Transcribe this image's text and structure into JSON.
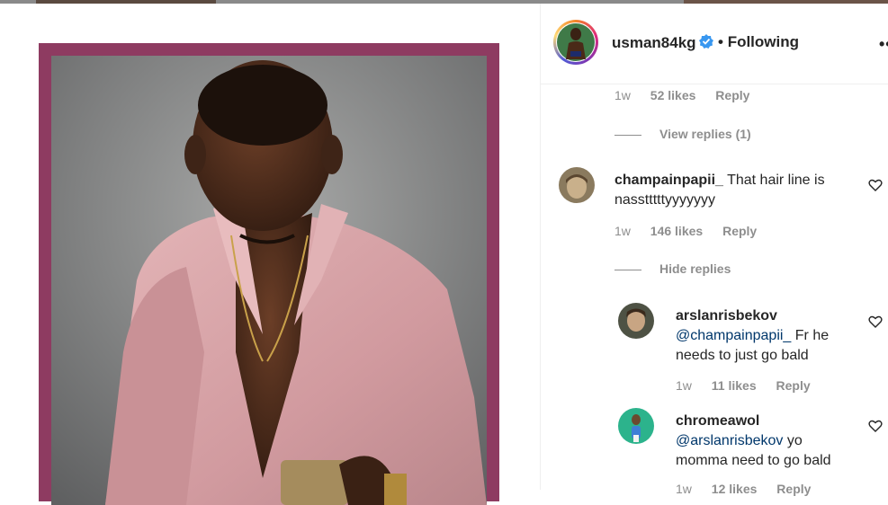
{
  "post": {
    "username": "usman84kg",
    "follow_status": "Following",
    "separator": "•",
    "more_label": "••",
    "image_alt": "Man in pink shirt looking at phone"
  },
  "comments_top": {
    "time": "1w",
    "likes": "52 likes",
    "reply": "Reply",
    "view_replies": "View replies (1)"
  },
  "comment1": {
    "user": "champainpapii_",
    "text_line1": "That hair line is",
    "text_line2": "nasstttttyyyyyyy",
    "time": "1w",
    "likes": "146 likes",
    "reply": "Reply",
    "hide_replies": "Hide replies"
  },
  "reply1": {
    "user": "arslanrisbekov",
    "mention": "@champainpapii_",
    "text_after": " Fr he",
    "text_line2": "needs to just go bald",
    "time": "1w",
    "likes": "11 likes",
    "reply": "Reply"
  },
  "reply2": {
    "user": "chromeawol",
    "mention": "@arslanrisbekov",
    "text_after": " yo",
    "text_line2": "momma need to go bald",
    "time": "1w",
    "likes": "12 likes",
    "reply": "Reply"
  },
  "colors": {
    "frame": "#8e3b61",
    "shirt": "#d9a7ab",
    "mention": "#00376b",
    "verified": "#3897f0"
  }
}
